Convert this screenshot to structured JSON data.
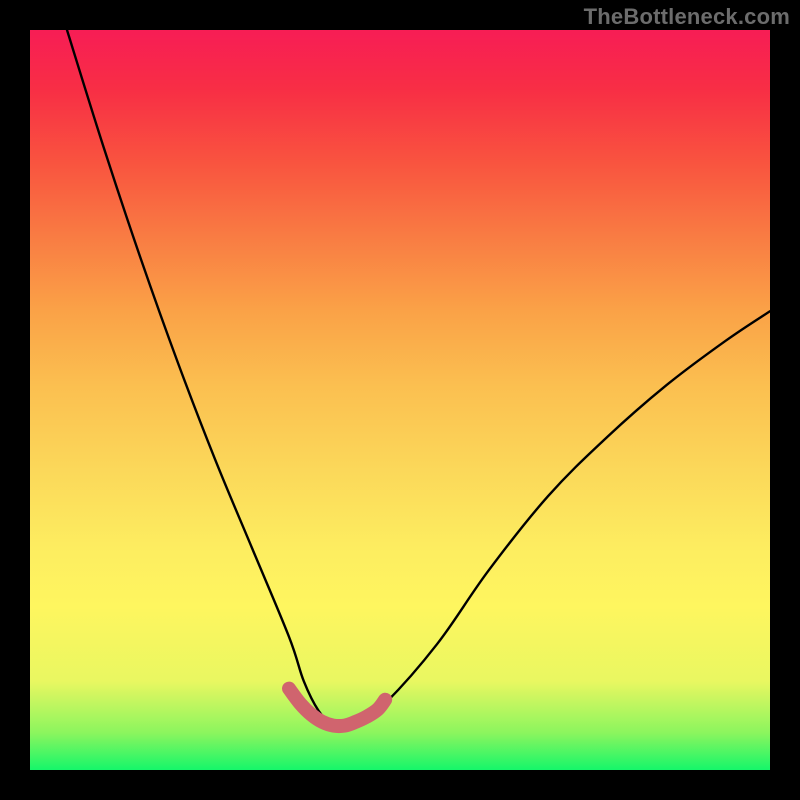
{
  "watermark": {
    "text": "TheBottleneck.com"
  },
  "chart_data": {
    "type": "line",
    "title": "",
    "xlabel": "",
    "ylabel": "",
    "xlim": [
      0,
      100
    ],
    "ylim": [
      0,
      100
    ],
    "grid": false,
    "series": [
      {
        "name": "main-curve",
        "color": "#000000",
        "x": [
          5,
          10,
          15,
          20,
          25,
          30,
          35,
          37,
          39,
          41,
          43,
          45,
          48,
          55,
          62,
          70,
          78,
          86,
          94,
          100
        ],
        "y": [
          100,
          84,
          69,
          55,
          42,
          30,
          18,
          12,
          8,
          6,
          6,
          7,
          9,
          17,
          27,
          37,
          45,
          52,
          58,
          62
        ]
      },
      {
        "name": "bottom-highlight",
        "color": "#d0646e",
        "x": [
          35,
          36.5,
          38,
          39.5,
          41,
          42.5,
          44,
          45.5,
          47,
          48
        ],
        "y": [
          11,
          9,
          7.5,
          6.5,
          6,
          6,
          6.5,
          7.2,
          8.2,
          9.5
        ]
      }
    ],
    "background": {
      "type": "vertical-gradient",
      "stops": [
        {
          "pos": 0,
          "color": "#15f66a"
        },
        {
          "pos": 12,
          "color": "#e9f761"
        },
        {
          "pos": 30,
          "color": "#fded60"
        },
        {
          "pos": 52,
          "color": "#fbbf50"
        },
        {
          "pos": 72,
          "color": "#f97c43"
        },
        {
          "pos": 100,
          "color": "#f71d55"
        }
      ]
    }
  }
}
